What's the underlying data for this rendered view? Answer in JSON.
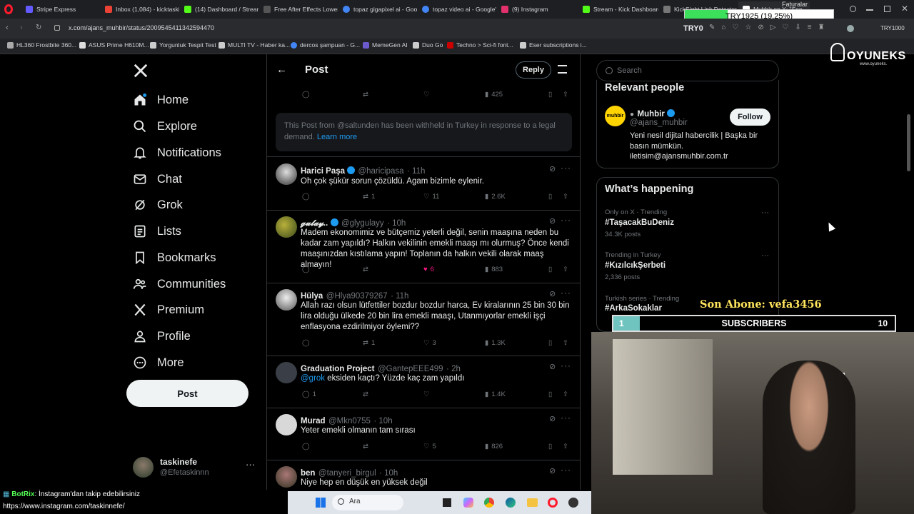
{
  "browser": {
    "tabs": [
      {
        "label": "Stripe Express",
        "color": "#635bff"
      },
      {
        "label": "Inbox (1,084) - kicktaskin",
        "color": "#ea4335"
      },
      {
        "label": "(14) Dashboard / Streamla",
        "color": "#53fc18"
      },
      {
        "label": "Free After Effects Lower T",
        "color": "#555555"
      },
      {
        "label": "topaz gigapixel ai - Goog",
        "color": "#4285f4"
      },
      {
        "label": "topaz video ai - Google'd",
        "color": "#4285f4"
      },
      {
        "label": "(9) Instagram",
        "color": "#e1306c"
      },
      {
        "label": "Stream - Kick Dashboard",
        "color": "#53fc18"
      },
      {
        "label": "KickSight Link Detector",
        "color": "#777777"
      },
      {
        "label": "Muhbir on X: \"Son",
        "color": "#ffffff"
      }
    ],
    "url": "x.com/ajans_muhbir/status/2009545411342594470",
    "currency_badge": "TRY0",
    "currency_right": "TRY1000",
    "bookmarks": [
      "HL360 Frostbite 360...",
      "ASUS Prime H610M...",
      "Yorgunluk Tespit Test",
      "MULTI TV - Haber ka...",
      "dercos şampuan - G...",
      "MemeGen AI",
      "Duo Go",
      "Techno > Sci-fi font...",
      "Eser subscriptions i..."
    ]
  },
  "overlay": {
    "faturalar": "Faturalar",
    "try_rate": "TRY1925 (19.25%)",
    "brand": "OYUNEKS",
    "brand_url": "www.oyuneks.",
    "last_sub_label": "Son Abone: vefa3456",
    "sub_count_left": "1",
    "subscribers_label": "SUBSCRIBERS",
    "sub_goal": "10",
    "chat_user": "BotRix",
    "chat_message": ": İnstagram'dan takip edebilirsiniz",
    "chat_link": "https://www.instagram.com/taskinnefe/"
  },
  "nav": {
    "items": [
      "Home",
      "Explore",
      "Notifications",
      "Chat",
      "Grok",
      "Lists",
      "Bookmarks",
      "Communities",
      "Premium",
      "Profile",
      "More"
    ],
    "post_label": "Post",
    "account_name": "taskinefe",
    "account_handle": "@Efetaskinnn"
  },
  "header": {
    "title": "Post",
    "reply_label": "Reply"
  },
  "top_actions": {
    "views": "425"
  },
  "withheld": {
    "text": "This Post from @saltunden has been withheld in Turkey in response to a legal demand.",
    "link": "Learn more"
  },
  "replies": [
    {
      "name": "Harici Paşa",
      "handle": "@haricipasa",
      "time": "· 11h",
      "text": "Oh çok şükür sorun çözüldü. Agam bizimle eylenir.",
      "replies": "",
      "reposts": "1",
      "likes": "11",
      "views": "2.6K"
    },
    {
      "name": "𝓰𝓾𝓵𝓪𝔂..",
      "handle": "@glygulayy",
      "time": "· 10h",
      "text": "Madem ekonomimiz ve bütçemiz yeterli değil, senin maaşına neden bu kadar zam yapıldı? Halkın vekilinin emekli maaşı mı olurmuş? Önce kendi maaşınızdan kıstılama yapın! Toplanın da halkın vekili olarak maaş almayın!",
      "replies": "",
      "reposts": "",
      "likes": "6",
      "views": "883"
    },
    {
      "name": "Hülya",
      "handle": "@Hlya90379267",
      "time": "· 11h",
      "text": "Allah razı olsun lütfettiler bozdur bozdur harca, Ev kiralarının 25 bin 30 bin lira olduğu ülkede 20 bin lira emekli maaşı, Utanmıyorlar emekli işçi enflasyona ezdirilmiyor öylemi??",
      "replies": "",
      "reposts": "1",
      "likes": "3",
      "views": "1.3K"
    },
    {
      "name": "Graduation Project",
      "handle": "@GantepEEE499",
      "time": "· 2h",
      "mention": "@grok",
      "text": " eksiden kaçtı? Yüzde kaç zam yapıldı",
      "replies": "1",
      "reposts": "",
      "likes": "",
      "views": "1.4K"
    },
    {
      "name": "Murad",
      "handle": "@Mkn0755",
      "time": "· 10h",
      "text": "Yeter emekli olmanın tam sırası",
      "replies": "",
      "reposts": "",
      "likes": "5",
      "views": "826"
    },
    {
      "name": "ben",
      "handle": "@tanyeri_birgul",
      "time": "· 10h",
      "text": "Niye hep en düşük en yüksek değil"
    }
  ],
  "sidebar": {
    "search_placeholder": "Search",
    "relevant_title": "Relevant people",
    "person_name": "Muhbir",
    "person_handle": "@ajans_muhbir",
    "person_bio": "Yeni nesil dijital habercilik | Başka bir basın mümkün. iletisim@ajansmuhbir.com.tr",
    "follow_label": "Follow",
    "happening_title": "What’s happening",
    "trends": [
      {
        "meta": "Only on X · Trending",
        "name": "#TaşacakBuDeniz",
        "count": "34.3K posts"
      },
      {
        "meta": "Trending in Turkey",
        "name": "#KızılcıkŞerbeti",
        "count": "2,336 posts"
      },
      {
        "meta": "Turkish series · Trending",
        "name": "#ArkaSokaklar",
        "count": ""
      }
    ]
  },
  "taskbar": {
    "search_placeholder": "Ara"
  }
}
